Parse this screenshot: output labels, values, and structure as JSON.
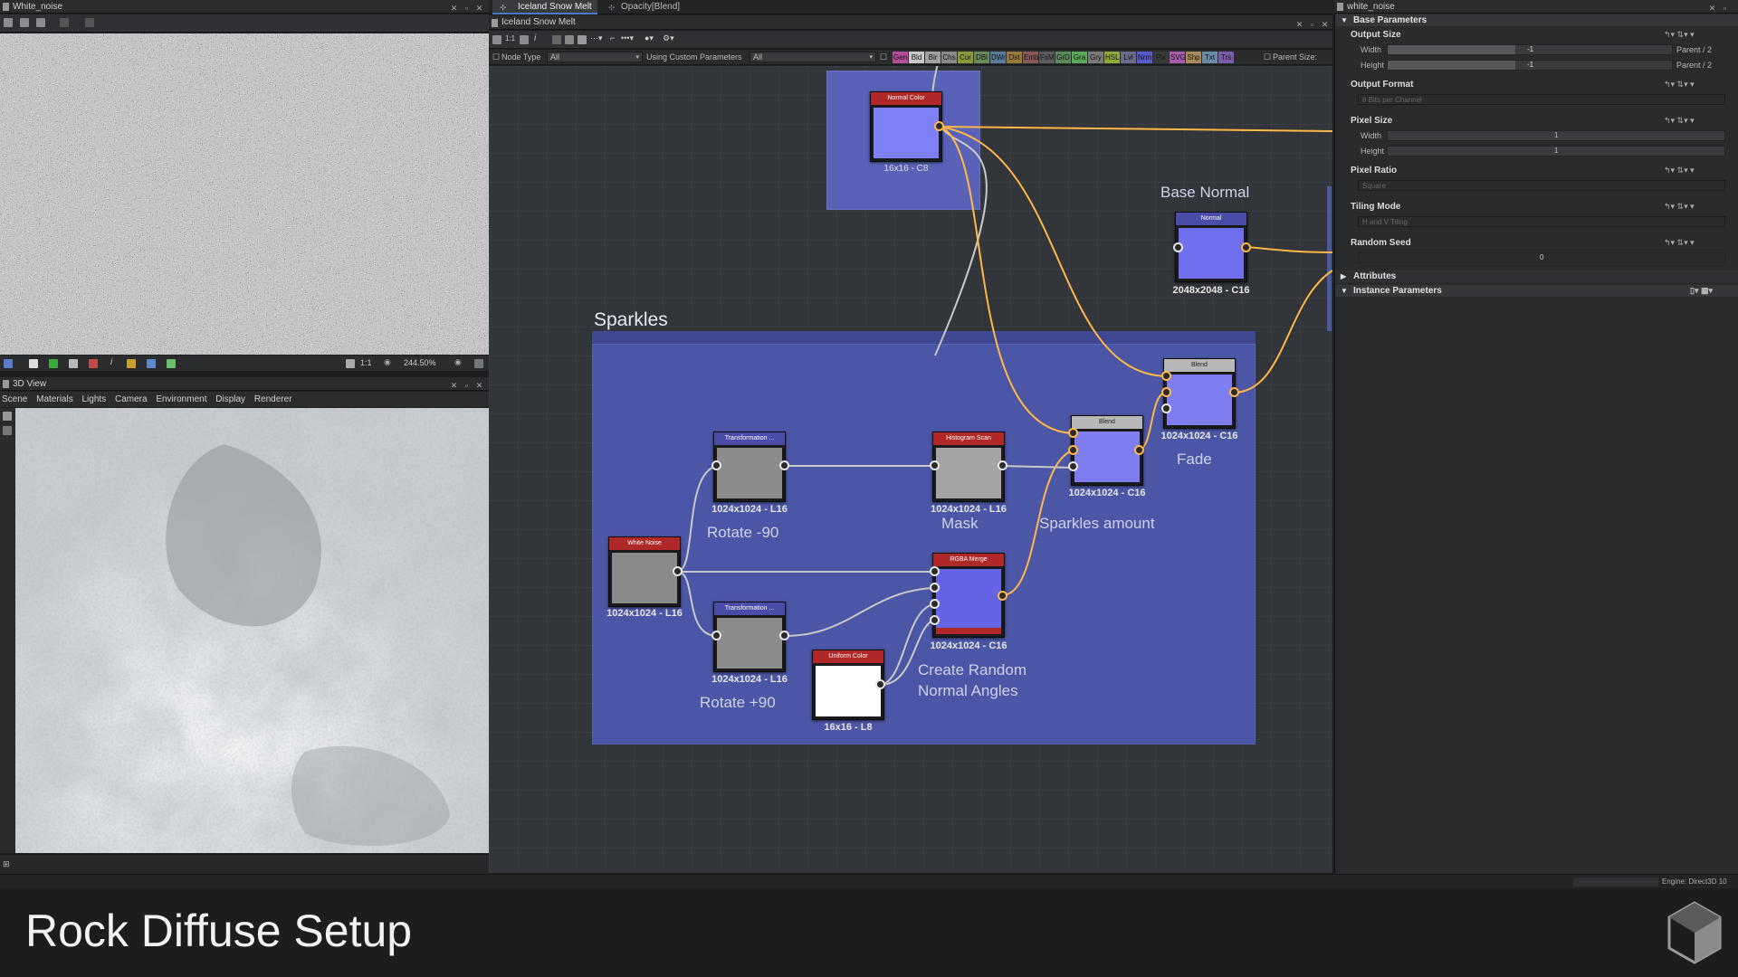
{
  "left_panel": {
    "title": "White_noise",
    "zoom": "244.50%",
    "ratio": "1:1"
  },
  "view3d": {
    "title": "3D View",
    "menu": [
      "Scene",
      "Materials",
      "Lights",
      "Camera",
      "Environment",
      "Display",
      "Renderer"
    ]
  },
  "graph": {
    "tabs": [
      {
        "label": "Iceland Snow Melt",
        "active": true
      },
      {
        "label": "Opacity[Blend]",
        "active": false
      }
    ],
    "subtitle": "Iceland Snow Melt",
    "node_type_label": "Node Type",
    "node_type_value": "All",
    "custom_params_label": "Using Custom Parameters",
    "custom_params_value": "All",
    "parent_size_label": "Parent Size:",
    "filter_chips": [
      {
        "label": "Gen",
        "color": "#b34d9a"
      },
      {
        "label": "Bld",
        "color": "#c8c8c8"
      },
      {
        "label": "Bir",
        "color": "#a0a0a0"
      },
      {
        "label": "Chs",
        "color": "#8a8a8a"
      },
      {
        "label": "Cur",
        "color": "#8a9a3a"
      },
      {
        "label": "DBl",
        "color": "#6a8a5a"
      },
      {
        "label": "DWr",
        "color": "#5a7a9a"
      },
      {
        "label": "Dst",
        "color": "#9a7a3a"
      },
      {
        "label": "Emb",
        "color": "#8a5a5a"
      },
      {
        "label": "FxM",
        "color": "#5a5a5a"
      },
      {
        "label": "GrD",
        "color": "#5a8a5a"
      },
      {
        "label": "Gra",
        "color": "#5aaa5a"
      },
      {
        "label": "Gry",
        "color": "#7a7a7a"
      },
      {
        "label": "HSL",
        "color": "#8aaa3a"
      },
      {
        "label": "Lvl",
        "color": "#6a6a8a"
      },
      {
        "label": "Nrm",
        "color": "#5a5acc"
      },
      {
        "label": "Pix",
        "color": "#3a3a3a"
      },
      {
        "label": "SVG",
        "color": "#aa5aaa"
      },
      {
        "label": "Shp",
        "color": "#aa8a5a"
      },
      {
        "label": "Txt",
        "color": "#6a8aaa"
      },
      {
        "label": "Trs",
        "color": "#7a5aaa"
      }
    ],
    "comments": {
      "sparkles": "Sparkles",
      "base_normal": "Base Normal",
      "fade": "Fade",
      "mask": "Mask",
      "sparkles_amount": "Sparkles amount",
      "rotate_neg": "Rotate -90",
      "rotate_pos": "Rotate +90",
      "create_random_1": "Create Random",
      "create_random_2": "Normal Angles"
    },
    "nodes": {
      "normal_color": {
        "title": "Normal Color",
        "size": "16x16 - C8"
      },
      "normal": {
        "title": "Normal",
        "size": "2048x2048 - C16"
      },
      "blend_fade": {
        "title": "Blend",
        "size": "1024x1024 - C16"
      },
      "blend_amount": {
        "title": "Blend",
        "size": "1024x1024 - C16"
      },
      "histogram_scan": {
        "title": "Histogram Scan",
        "size": "1024x1024 - L16"
      },
      "transform_top": {
        "title": "Transformation ...",
        "size": "1024x1024 - L16"
      },
      "transform_bottom": {
        "title": "Transformation ...",
        "size": "1024x1024 - L16"
      },
      "white_noise": {
        "title": "White Noise",
        "size": "1024x1024 - L16"
      },
      "rgba_merge": {
        "title": "RGBA Merge",
        "size": "1024x1024 - C16"
      },
      "uniform_color": {
        "title": "Uniform Color",
        "size": "16x16 - L8"
      }
    }
  },
  "properties": {
    "title": "white_noise",
    "base_parameters": "Base Parameters",
    "output_size": {
      "label": "Output Size",
      "width_label": "Width",
      "width_value": "-1",
      "width_suffix": "Parent / 2",
      "height_label": "Height",
      "height_value": "-1",
      "height_suffix": "Parent / 2"
    },
    "output_format": {
      "label": "Output Format",
      "value": "8 Bits per Channel"
    },
    "pixel_size": {
      "label": "Pixel Size",
      "width_label": "Width",
      "width_value": "1",
      "height_label": "Height",
      "height_value": "1"
    },
    "pixel_ratio": {
      "label": "Pixel Ratio",
      "value": "Square"
    },
    "tiling_mode": {
      "label": "Tiling Mode",
      "value": "H and V Tiling"
    },
    "random_seed": {
      "label": "Random Seed",
      "value": "0"
    },
    "attributes": "Attributes",
    "instance_parameters": "Instance Parameters"
  },
  "status": {
    "engine": "Engine: Direct3D 10"
  },
  "caption": {
    "text": "Rock Diffuse Setup"
  }
}
